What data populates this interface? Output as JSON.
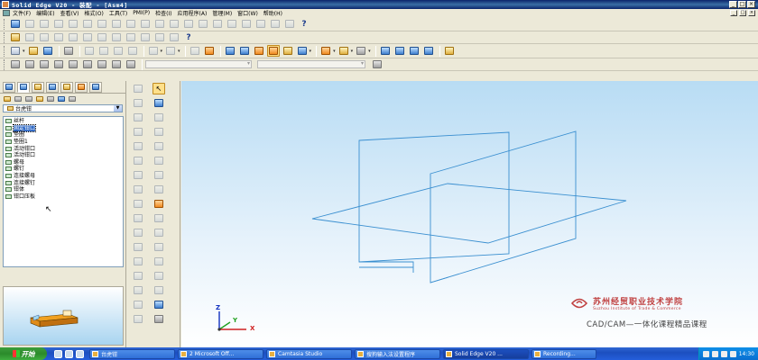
{
  "window": {
    "title": "Solid Edge V20 - 装配 - [Asm4]",
    "controls": [
      "_",
      "□",
      "×"
    ]
  },
  "menu": {
    "items": [
      "文件(F)",
      "编辑(E)",
      "查看(V)",
      "格式(O)",
      "工具(T)",
      "PMI(P)",
      "检查(I)",
      "应用程序(A)",
      "管理(M)",
      "窗口(W)",
      "帮助(H)"
    ],
    "doc_controls": [
      "_",
      "□",
      "×"
    ]
  },
  "toolbars": {
    "help_glyph": "?"
  },
  "edgebar": {
    "filter_combo": "台虎钳",
    "tree": {
      "root": "台虎钳",
      "items": [
        "丝杆",
        "固定钳口",
        "垫圈",
        "垫圈1",
        "活动钳口",
        "活动钳口",
        "螺母",
        "螺钉",
        "连接螺母",
        "连接螺钉",
        "钳体",
        "钳口压板"
      ],
      "selected_index": 1
    }
  },
  "canvas": {
    "triad": {
      "x": "X",
      "y": "Y",
      "z": "Z"
    },
    "watermark": {
      "school_cn": "苏州经贸职业技术学院",
      "school_en": "Suzhou Institute of Trade & Commerce",
      "course": "CAD/CAM—一体化课程精品课程"
    }
  },
  "taskbar": {
    "start_label": "开始",
    "tasks": [
      {
        "label": "台虎钳",
        "active": false
      },
      {
        "label": "2 Microsoft Off...",
        "active": false
      },
      {
        "label": "Camtasia Studio",
        "active": false
      },
      {
        "label": "搜狗输入法设置程序",
        "active": false
      },
      {
        "label": "Solid Edge V20 ...",
        "active": true
      },
      {
        "label": "Recording...",
        "active": false
      }
    ],
    "clock": "14:30"
  },
  "colors": {
    "titlebar": "#0a246a",
    "canvas_top": "#b8dcf4",
    "plane_lines": "#3a8fd0",
    "selection": "#316ac5",
    "watermark": "#c04040"
  }
}
